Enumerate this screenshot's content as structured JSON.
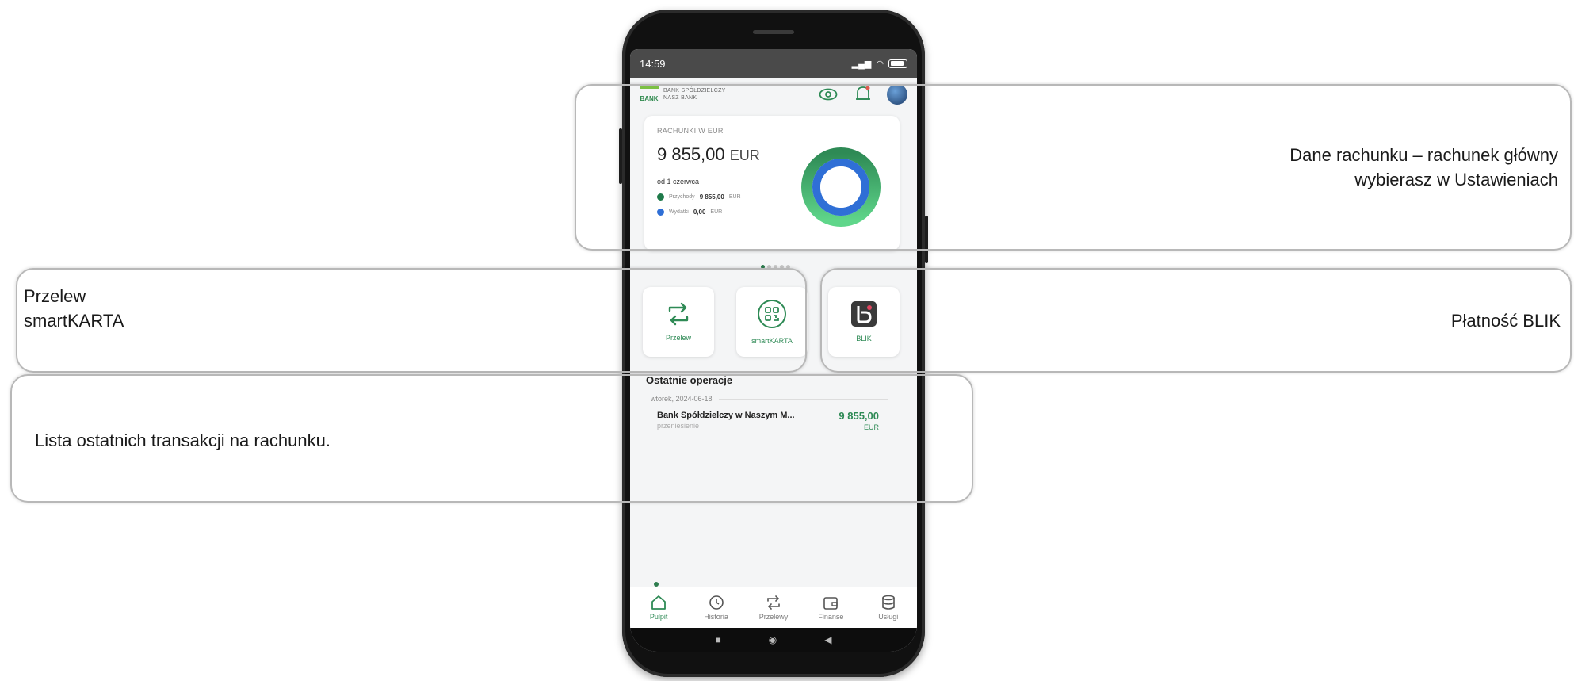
{
  "status_bar": {
    "time": "14:59",
    "battery_label": "100"
  },
  "bank": {
    "name_line1": "BANK SPÓŁDZIELCZY",
    "name_line2": "NASZ BANK",
    "logo_text": "BANK"
  },
  "account": {
    "label": "RACHUNKI W EUR",
    "amount": "9 855,00",
    "currency": "EUR",
    "since": "od 1 czerwca",
    "income_label": "Przychody",
    "income_value": "9 855,00",
    "income_currency": "EUR",
    "expense_label": "Wydatki",
    "expense_value": "0,00",
    "expense_currency": "EUR",
    "colors": {
      "income": "#2e8a55",
      "expense": "#2f6fd6"
    }
  },
  "quick_actions": [
    {
      "label": "Przelew",
      "icon": "transfer-icon"
    },
    {
      "label": "smartKARTA",
      "icon": "qr-card-icon"
    },
    {
      "label": "BLIK",
      "icon": "blik-icon"
    }
  ],
  "operations": {
    "title": "Ostatnie operacje",
    "date": "wtorek, 2024-06-18",
    "items": [
      {
        "name": "Bank Spółdzielczy w Naszym M...",
        "type": "przeniesienie",
        "amount": "9 855,00",
        "currency": "EUR"
      }
    ]
  },
  "nav": [
    {
      "label": "Pulpit",
      "icon": "home-icon"
    },
    {
      "label": "Historia",
      "icon": "history-icon"
    },
    {
      "label": "Przelewy",
      "icon": "transfers-icon"
    },
    {
      "label": "Finanse",
      "icon": "finance-icon"
    },
    {
      "label": "Usługi",
      "icon": "services-icon"
    }
  ],
  "annotations": {
    "account_line1": "Dane rachunku – rachunek główny",
    "account_line2": "wybierasz w Ustawieniach",
    "actions_line1": "Przelew",
    "actions_line2": "smartKARTA",
    "blik": "Płatność BLIK",
    "list": "Lista ostatnich transakcji na rachunku."
  },
  "theme": {
    "accent": "#2e8a55",
    "blue": "#2f6fd6",
    "callout_border": "#b8b8b8"
  }
}
